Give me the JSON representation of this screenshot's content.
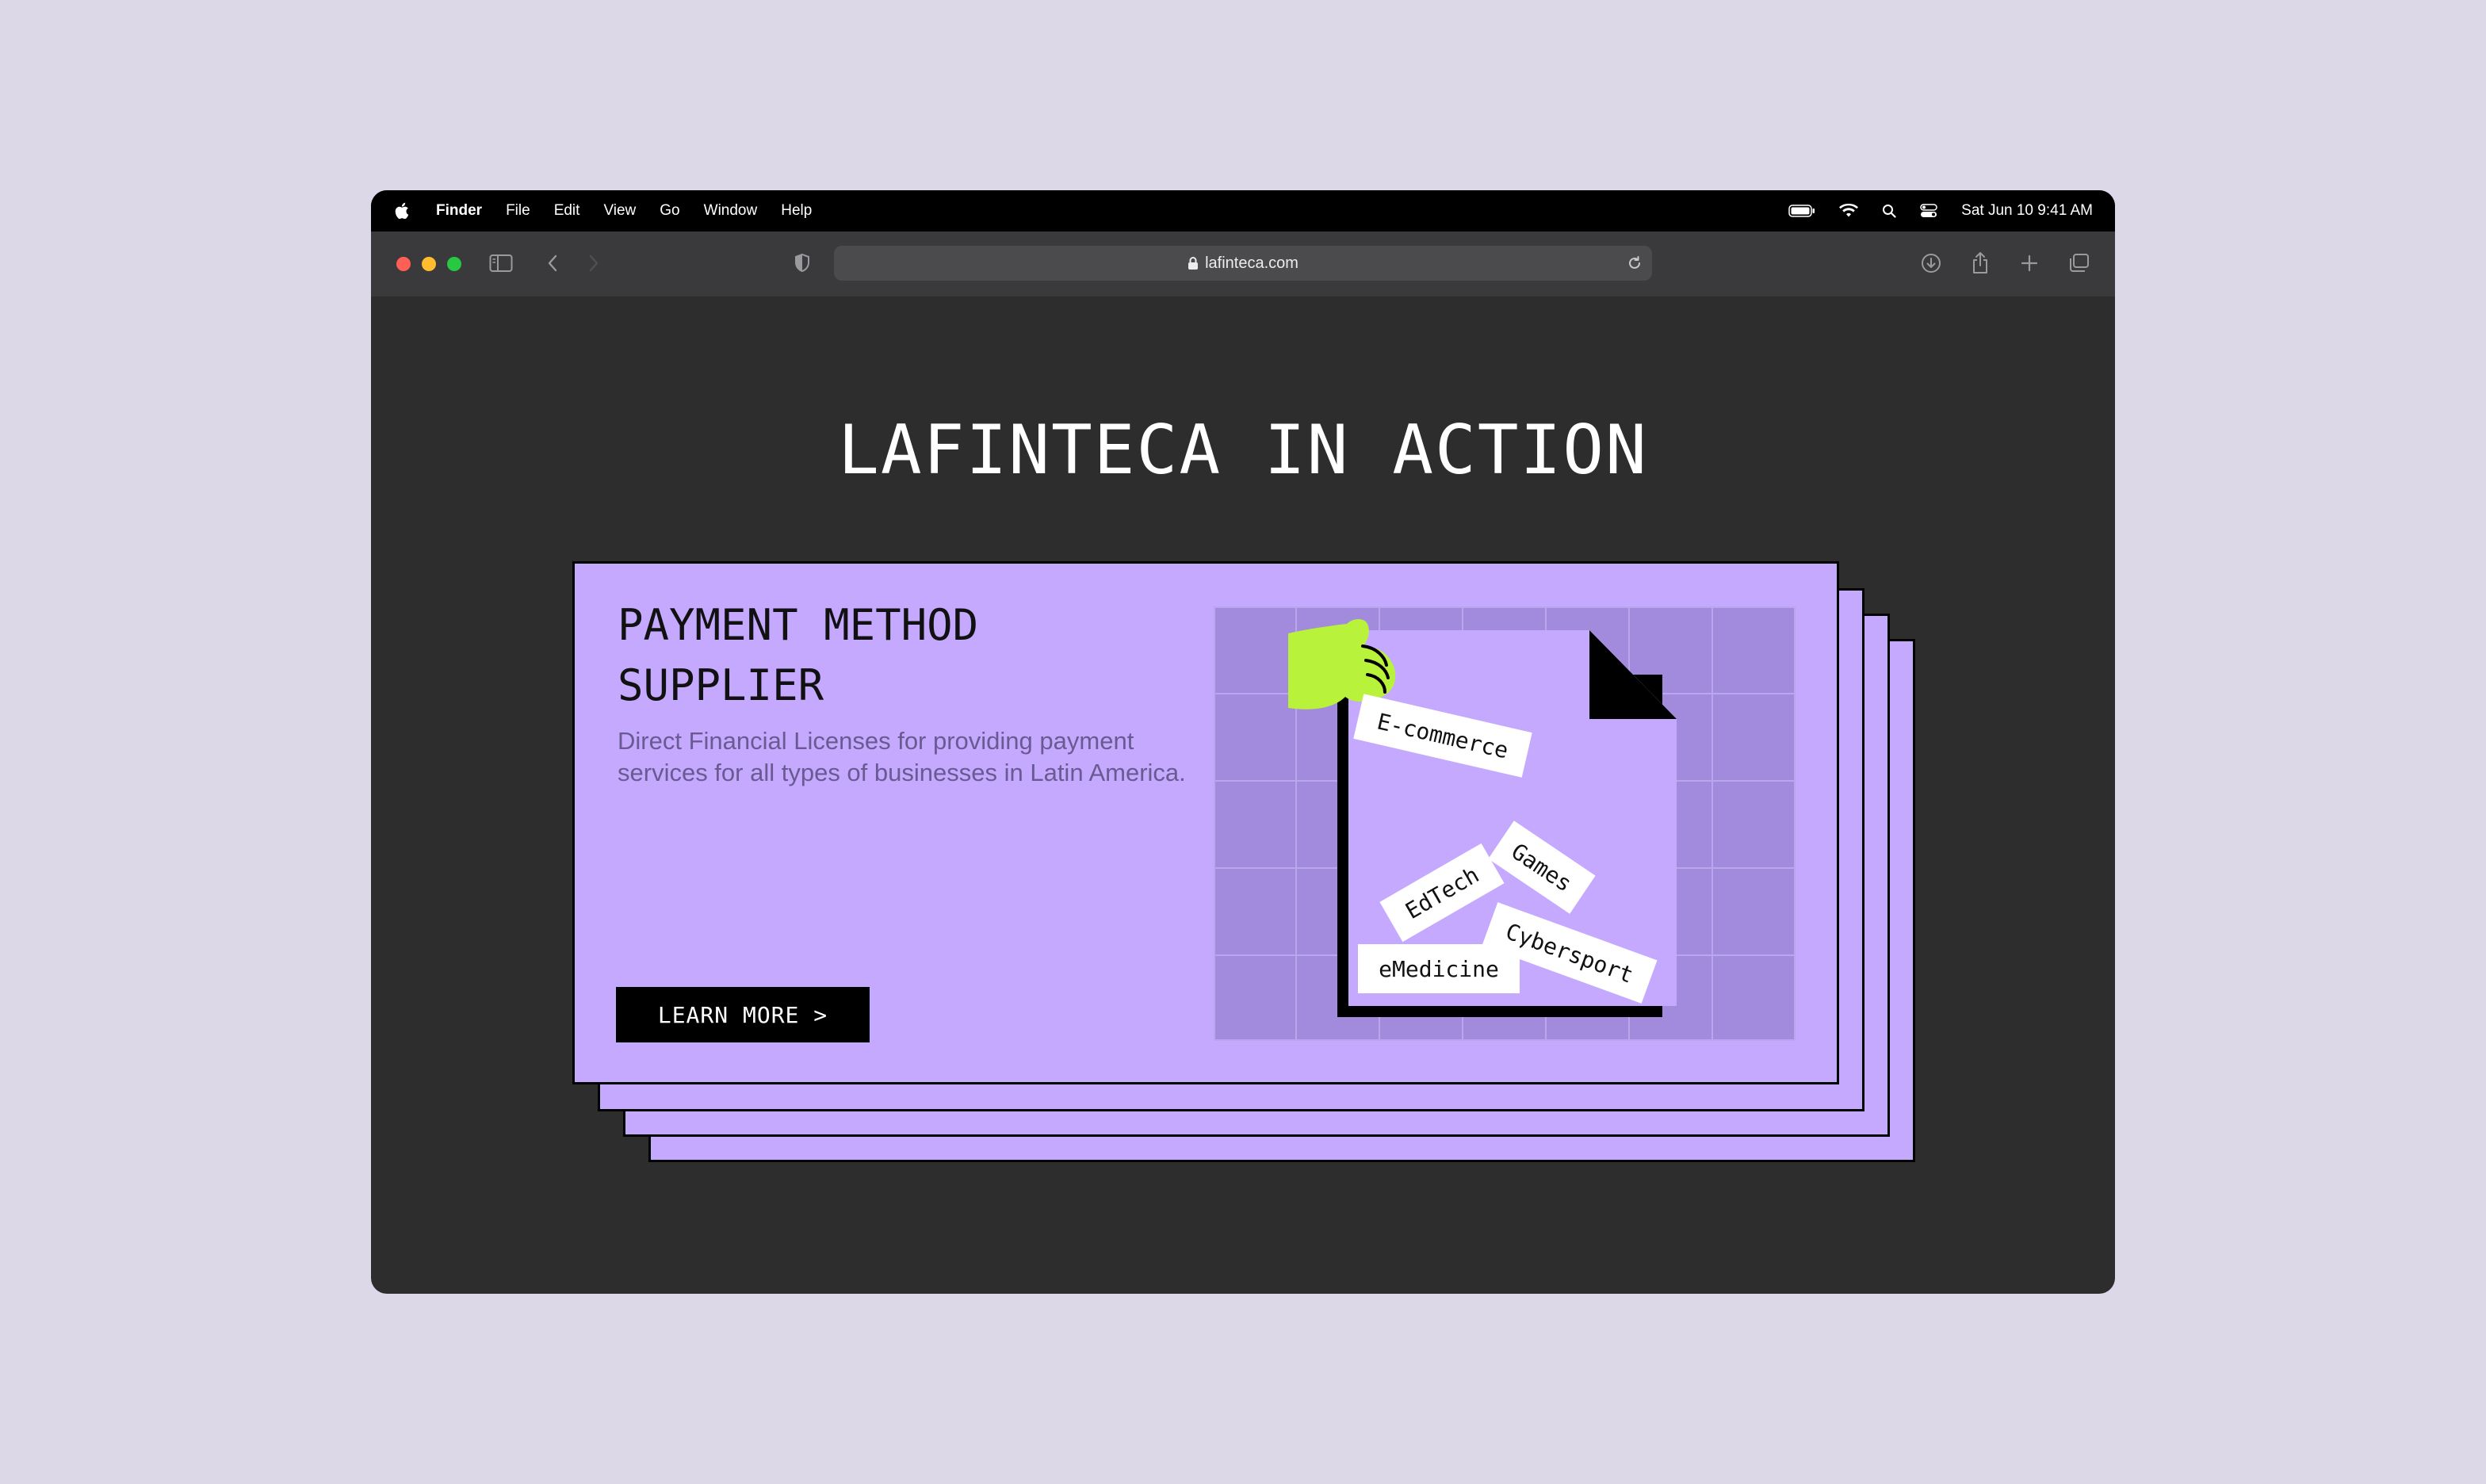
{
  "menubar": {
    "app_name": "Finder",
    "menus": [
      "File",
      "Edit",
      "View",
      "Go",
      "Window",
      "Help"
    ],
    "datetime": "Sat Jun 10  9:41 AM"
  },
  "browser": {
    "url": "lafinteca.com",
    "traffic_colors": [
      "#ff5f57",
      "#febc2e",
      "#28c840"
    ]
  },
  "page": {
    "title": "LAFINTECA IN ACTION",
    "card": {
      "title_line1": "PAYMENT METHOD",
      "title_line2": "SUPPLIER",
      "description": "Direct Financial Licenses for providing payment services for all types of businesses in Latin America.",
      "button_label": "LEARN MORE >"
    },
    "tags": [
      "E-commerce",
      "Games",
      "EdTech",
      "Cybersport",
      "eMedicine"
    ]
  },
  "colors": {
    "background": "#dcd8e8",
    "card": "#c4a9ff",
    "grid_cell": "#a28bdc",
    "hand": "#b8f23a"
  }
}
